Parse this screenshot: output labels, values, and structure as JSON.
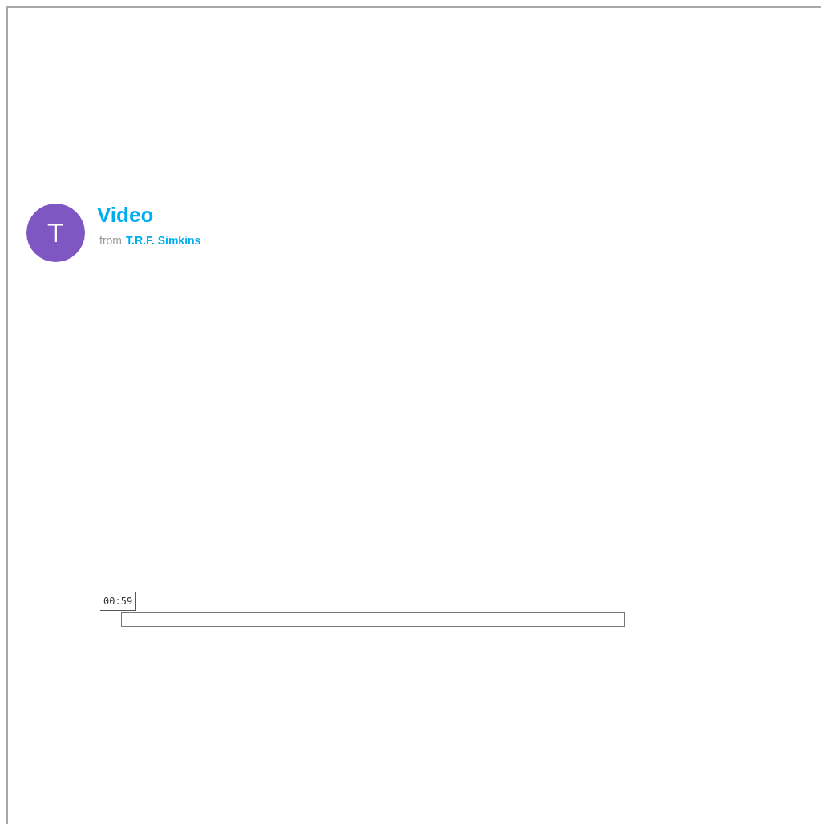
{
  "post": {
    "title": "Video",
    "from_label": "from",
    "author": "T.R.F. Simkins",
    "avatar_letter": "T"
  },
  "player": {
    "time": "00:59",
    "level": 0
  }
}
